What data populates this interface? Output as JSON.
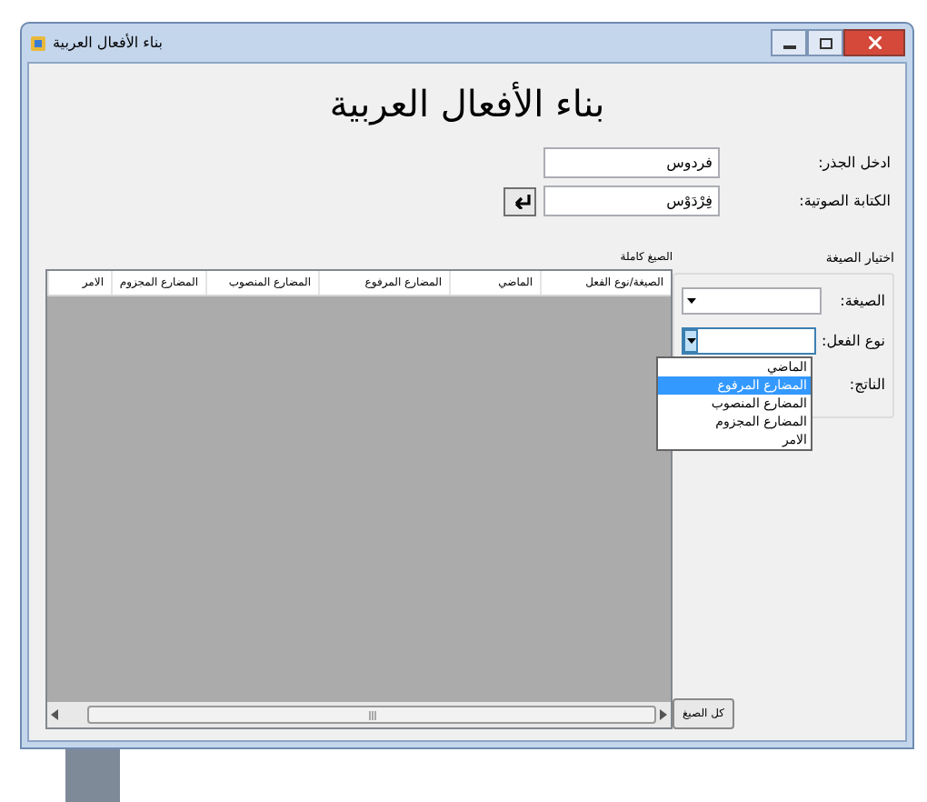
{
  "window": {
    "title": "بناء الأفعال العربية"
  },
  "heading": "بناء الأفعال العربية",
  "fields": [
    {
      "label": "ادخل الجذر:",
      "value": "فردوس"
    },
    {
      "label": "الكتابة الصوتية:",
      "value": "فِرْدَوْس"
    }
  ],
  "form_group": {
    "title": "اختيار الصيغة",
    "combos": [
      {
        "label": "الصيغة:",
        "expanded": false
      },
      {
        "label": "نوع الفعل:",
        "expanded": true
      }
    ],
    "output_label": "الناتج:",
    "options": [
      {
        "label": "الماضي",
        "selected": false
      },
      {
        "label": "المضارع المرفوع",
        "selected": true
      },
      {
        "label": "المضارع المنصوب",
        "selected": false
      },
      {
        "label": "المضارع المجزوم",
        "selected": false
      },
      {
        "label": "الامر",
        "selected": false
      }
    ]
  },
  "table": {
    "title": "الصيغ كاملة",
    "columns": [
      "الصيغة/نوع الفعل",
      "الماضي",
      "المضارع المرفوع",
      "المضارع المنصوب",
      "المضارع المجزوم",
      "الامر"
    ]
  },
  "button": "كل الصيغ"
}
